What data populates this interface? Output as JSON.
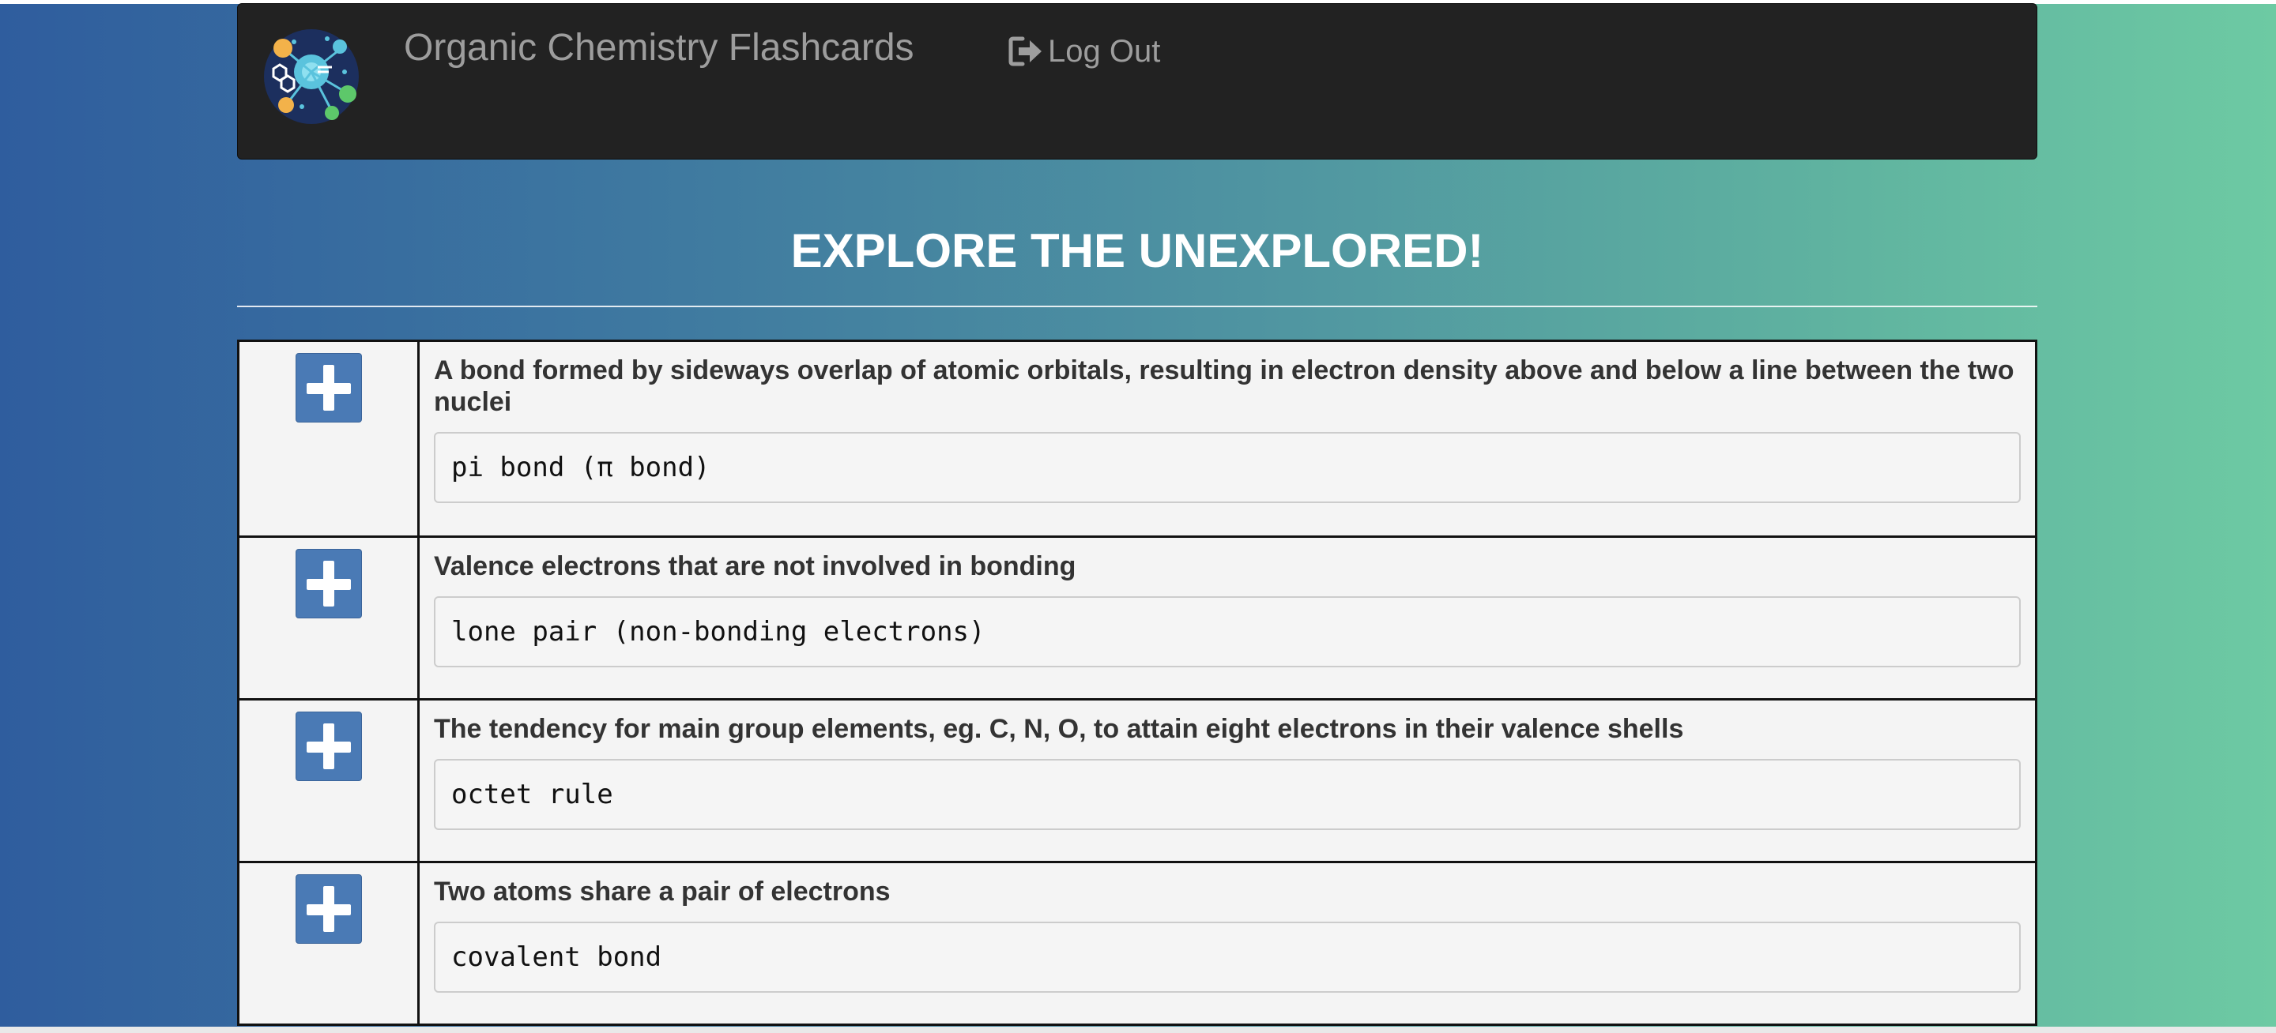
{
  "navbar": {
    "brand": "Organic Chemistry Flashcards",
    "logout_label": "Log Out",
    "logo_icon": "molecule-logo-icon",
    "logout_icon": "log-out-icon"
  },
  "main": {
    "heading": "EXPLORE THE UNEXPLORED!"
  },
  "cards": [
    {
      "definition": "A bond formed by sideways overlap of atomic orbitals, resulting in electron density above and below a line between the two nuclei",
      "term": "pi bond (π bond)"
    },
    {
      "definition": "Valence electrons that are not involved in bonding",
      "term": "lone pair (non-bonding electrons)"
    },
    {
      "definition": "The tendency for main group elements, eg. C, N, O, to attain eight electrons in their valence shells",
      "term": "octet rule"
    },
    {
      "definition": "Two atoms share a pair of electrons",
      "term": "covalent bond"
    }
  ],
  "colors": {
    "navbar_bg": "#222222",
    "add_button": "#4a7ab5",
    "gradient_left": "#2f5d9e",
    "gradient_right": "#6dcaa3"
  }
}
